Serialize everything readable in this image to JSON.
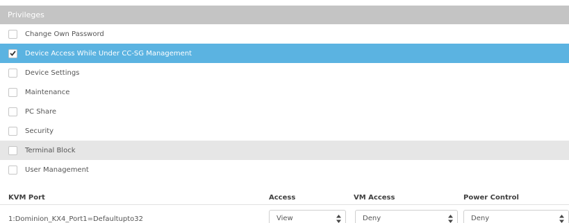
{
  "privileges": {
    "header": "Privileges",
    "items": [
      {
        "label": "Change Own Password",
        "checked": false
      },
      {
        "label": "Device Access While Under CC-SG Management",
        "checked": true
      },
      {
        "label": "Device Settings",
        "checked": false
      },
      {
        "label": "Maintenance",
        "checked": false
      },
      {
        "label": "PC Share",
        "checked": false
      },
      {
        "label": "Security",
        "checked": false
      },
      {
        "label": "Terminal Block",
        "checked": false
      },
      {
        "label": "User Management",
        "checked": false
      }
    ]
  },
  "kvm_table": {
    "headers": {
      "port": "KVM Port",
      "access": "Access",
      "vm_access": "VM Access",
      "power_control": "Power Control"
    },
    "rows": [
      {
        "port": "1:Dominion_KX4_Port1=Defaultupto32",
        "access": "View",
        "vm_access": "Deny",
        "power_control": "Deny"
      }
    ]
  },
  "colors": {
    "header_bg": "#c4c4c4",
    "selected_row_bg": "#5bb3e1",
    "hover_row_bg": "#e6e6e6"
  }
}
